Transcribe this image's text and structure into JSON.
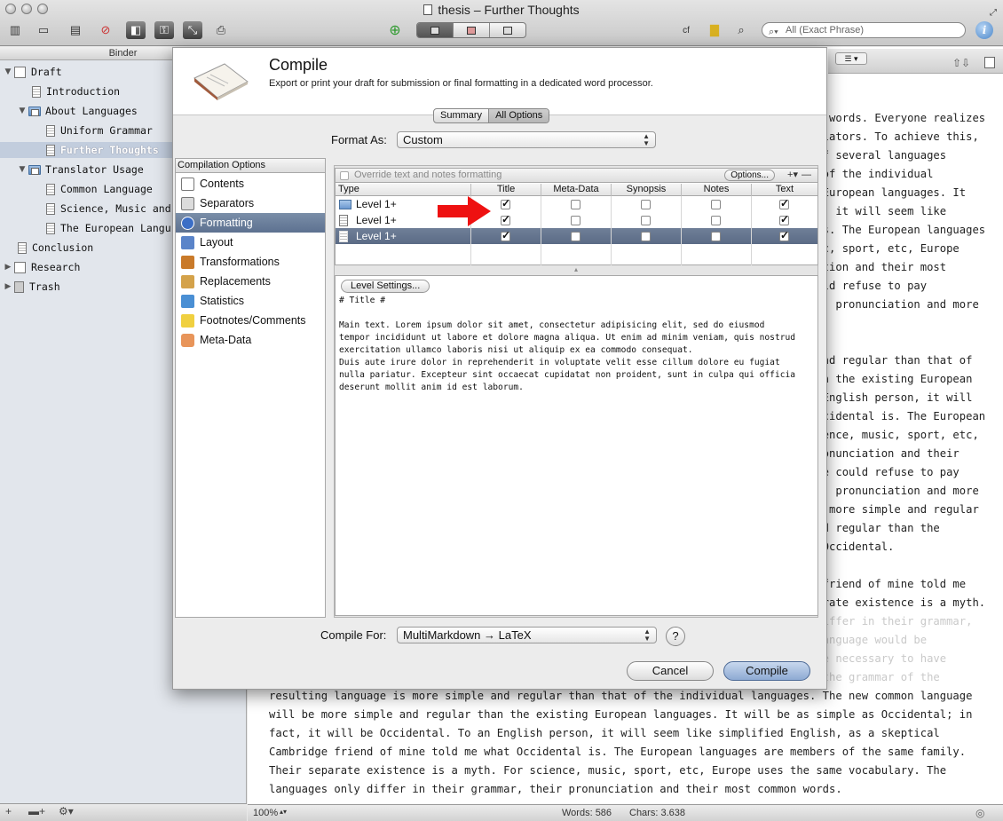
{
  "window": {
    "title": "thesis – Further Thoughts"
  },
  "toolbar": {
    "search_placeholder": "All (Exact Phrase)"
  },
  "binder": {
    "header": "Binder",
    "items": [
      {
        "label": "Draft"
      },
      {
        "label": "Introduction"
      },
      {
        "label": "About Languages"
      },
      {
        "label": "Uniform Grammar"
      },
      {
        "label": "Further Thoughts"
      },
      {
        "label": "Translator Usage"
      },
      {
        "label": "Common Language"
      },
      {
        "label": "Science, Music and"
      },
      {
        "label": "The European Langu"
      },
      {
        "label": "Conclusion"
      },
      {
        "label": "Research"
      },
      {
        "label": "Trash"
      }
    ]
  },
  "compile": {
    "title": "Compile",
    "subtitle": "Export or print your draft for submission or final formatting in a dedicated word processor.",
    "tabs": {
      "summary": "Summary",
      "all_options": "All Options"
    },
    "format_as_label": "Format As:",
    "format_as_value": "Custom",
    "options_header": "Compilation Options",
    "options": [
      {
        "label": "Contents",
        "color": "#ffffff"
      },
      {
        "label": "Separators",
        "color": "#dcdcdc"
      },
      {
        "label": "Formatting",
        "color": "#3b6ec6"
      },
      {
        "label": "Layout",
        "color": "#5a84c9"
      },
      {
        "label": "Transformations",
        "color": "#c97a2a"
      },
      {
        "label": "Replacements",
        "color": "#d4a24a"
      },
      {
        "label": "Statistics",
        "color": "#4a8fd4"
      },
      {
        "label": "Footnotes/Comments",
        "color": "#f0d040"
      },
      {
        "label": "Meta-Data",
        "color": "#e8955a"
      }
    ],
    "override_label": "Override text and notes formatting",
    "options_button": "Options...",
    "table": {
      "columns": [
        "Type",
        "Title",
        "Meta-Data",
        "Synopsis",
        "Notes",
        "Text"
      ],
      "rows": [
        {
          "label": "Level  1+",
          "icon": "folder-icon",
          "title": true,
          "metadata": false,
          "synopsis": false,
          "notes": false,
          "text": true
        },
        {
          "label": "Level  1+",
          "icon": "text-stack-icon",
          "title": true,
          "metadata": false,
          "synopsis": false,
          "notes": false,
          "text": true
        },
        {
          "label": "Level  1+",
          "icon": "document-icon",
          "title": true,
          "metadata": false,
          "synopsis": false,
          "notes": false,
          "text": true
        }
      ]
    },
    "level_settings_button": "Level Settings...",
    "preview_title": "# Title #",
    "preview_body": "Main text. Lorem ipsum dolor sit amet, consectetur adipisicing elit, sed do eiusmod\ntempor incididunt ut labore et dolore magna aliqua. Ut enim ad minim veniam, quis nostrud\nexercitation ullamco laboris nisi ut aliquip ex ea commodo consequat.\nDuis aute irure dolor in reprehenderit in voluptate velit esse cillum dolore eu fugiat\nnulla pariatur. Excepteur sint occaecat cupidatat non proident, sunt in culpa qui officia\ndeserunt mollit anim id est laborum.",
    "compile_for_label": "Compile For:",
    "compile_for_value": "MultiMarkdown → LaTeX",
    "help_label": "?",
    "cancel_label": "Cancel",
    "compile_label": "Compile"
  },
  "editor": {
    "lines_top": [
      "The languages only differ in their grammar, their pronunciation and their most common words. Everyone realizes",
      "why a new common language would be desirable: one could refuse to pay expensive translators. To achieve this,",
      "it would be necessary to have uniform grammar, pronunciation and more common words. If several languages",
      "coalesce, the grammar of the resulting language is more simple and regular than that of the individual",
      "languages. The new common language will be more simple and regular than the existing European languages. It",
      "will be as simple as Occidental; in fact, it will be Occidental. To an English person, it will seem like",
      "simplified English, as a skeptical Cambridge friend of mine told me what Occidental is. The European languages",
      "are members of the same family. Their separate existence is a myth. For science, music, sport, etc, Europe",
      "uses the same vocabulary. The languages only differ in their grammar, their pronunciation and their most",
      "common words. Everyone realizes why a new common language would be desirable: one could refuse to pay",
      "expensive translators. To achieve this, it would be necessary to have uniform grammar, pronunciation and more",
      "common words.",
      "",
      "If several languages coalesce, the grammar of the resulting language is more simple and regular than that of",
      "the individual languages. The new common language will be more simple and regular than the existing European",
      "languages. It will be as simple as Occidental; in fact, it will be Occidental. To an English person, it will",
      "seem like simplified English, as a skeptical Cambridge friend of mine told me what Occidental is. The European",
      "languages are members of the same family. Their separate existence is a myth. For science, music, sport, etc,",
      "Europe uses the same vocabulary. The languages only differ in their grammar, their pronunciation and their",
      "most common words. Everyone realizes why a new common language would be desirable: one could refuse to pay",
      "expensive translators. To achieve this, it would be necessary to have uniform grammar, pronunciation and more",
      "common words. If several languages coalesce, the grammar of the resulting language is more simple and regular",
      "than that of the individual languages. The new common language will be more simple and regular than the",
      "existing European languages. It will be as simple as Occidental; in fact, it will be Occidental.",
      "",
      "To an English person, it will seem like simplified English, as a skeptical Cambridge friend of mine told me",
      "what Occidental is. The European languages are members of the same family. Their separate existence is a myth.",
      "For science, music, sport, etc, Europe uses the same vocabulary. The languages only differ in their grammar,",
      "their pronunciation and their most common words. Everyone realizes why a new common language would be",
      "desirable: one could refuse to pay expensive translators. To achieve this, it would be necessary to have",
      "uniform grammar, pronunciation and more common words. If several languages coalesce, the grammar of the"
    ],
    "lines_bottom": [
      "resulting language is more simple and regular than that of the individual languages. The new common language",
      "will be more simple and regular than the existing European languages. It will be as simple as Occidental; in",
      "fact, it will be Occidental. To an English person, it will seem like simplified English, as a skeptical",
      "Cambridge friend of mine told me what Occidental is. The European languages are members of the same family.",
      "Their separate existence is a myth. For science, music, sport, etc, Europe uses the same vocabulary. The",
      "languages only differ in their grammar, their pronunciation and their most common words."
    ]
  },
  "status": {
    "zoom": "100%",
    "words": "Words: 586",
    "chars": "Chars: 3.638"
  }
}
